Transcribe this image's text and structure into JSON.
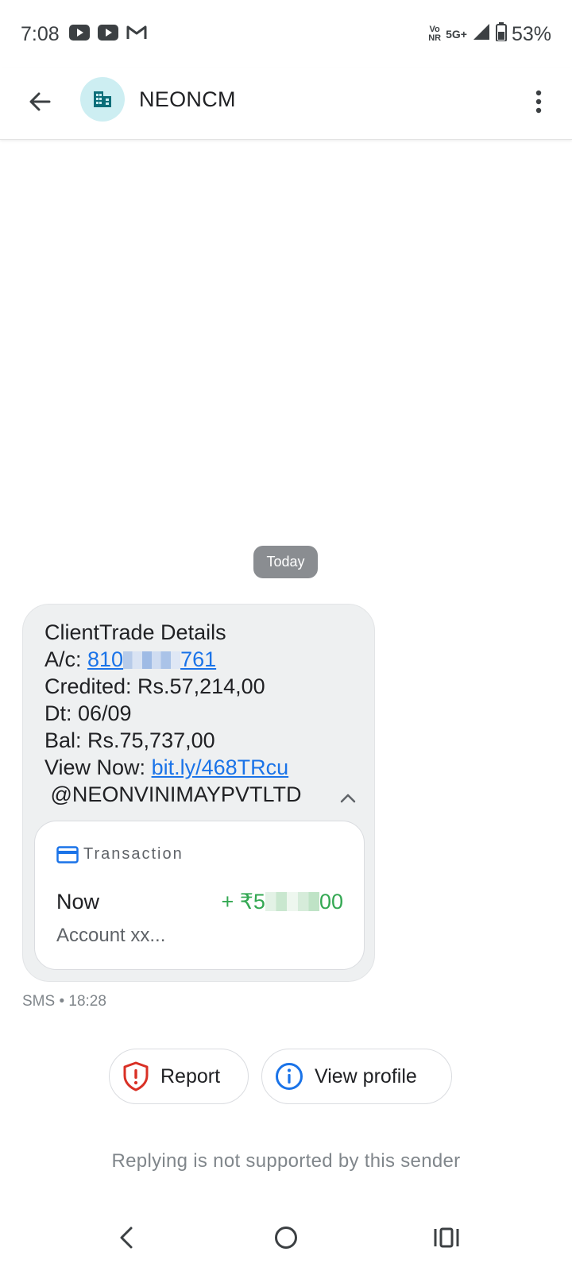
{
  "status_bar": {
    "time": "7:08",
    "left_icons": [
      "youtube-icon",
      "youtube-icon",
      "gmail-icon"
    ],
    "vo_nr_top": "Vo",
    "vo_nr_bottom": "NR",
    "network": "5G+",
    "battery": "53%"
  },
  "app_bar": {
    "sender": "NEONCM",
    "avatar_icon": "business-icon",
    "accent": "#cdeef2"
  },
  "conversation": {
    "date_chip": "Today",
    "message": {
      "line1": "ClientTrade Details",
      "ac_prefix": "A/c: ",
      "ac_start": "810",
      "ac_end": "761",
      "credited": "Credited: Rs.57,214,00",
      "date": "Dt: 06/09",
      "balance": "Bal: Rs.75,737,00",
      "view_prefix": "View Now: ",
      "link": "bit.ly/468TRcu",
      "signature": " @NEONVINIMAYPVTLTD"
    },
    "transaction_card": {
      "label": "Transaction",
      "when": "Now",
      "amount_prefix": "+ ₹5",
      "amount_suffix": "00",
      "account": "Account xx...",
      "amount_color": "#34a853"
    },
    "meta": "SMS • 18:28"
  },
  "actions": {
    "report": "Report",
    "view_profile": "View profile"
  },
  "footer_note": "Replying is not supported by this sender",
  "colors": {
    "link": "#1a73e8",
    "report_icon": "#d93025",
    "info_icon": "#1a73e8",
    "bubble": "#eef0f1"
  }
}
